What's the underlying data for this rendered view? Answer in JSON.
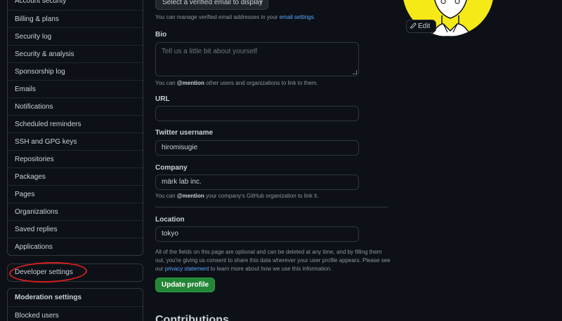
{
  "sidebar": {
    "items": [
      {
        "label": "Account security"
      },
      {
        "label": "Billing & plans"
      },
      {
        "label": "Security log"
      },
      {
        "label": "Security & analysis"
      },
      {
        "label": "Sponsorship log"
      },
      {
        "label": "Emails"
      },
      {
        "label": "Notifications"
      },
      {
        "label": "Scheduled reminders"
      },
      {
        "label": "SSH and GPG keys"
      },
      {
        "label": "Repositories"
      },
      {
        "label": "Packages"
      },
      {
        "label": "Pages"
      },
      {
        "label": "Organizations"
      },
      {
        "label": "Saved replies"
      },
      {
        "label": "Applications"
      }
    ],
    "developer_settings": "Developer settings",
    "moderation": {
      "heading": "Moderation settings",
      "items": [
        {
          "label": "Blocked users"
        }
      ]
    }
  },
  "form": {
    "email_select": "Select a verified email to display",
    "email_note_prefix": "You can manage verified email addresses in your",
    "email_note_link": "email settings.",
    "bio_label": "Bio",
    "bio_placeholder": "Tell us a little bit about yourself",
    "bio_note_prefix": "You can",
    "bio_note_mention": "@mention",
    "bio_note_suffix": "other users and organizations to link to them.",
    "url_label": "URL",
    "url_value": "",
    "twitter_label": "Twitter username",
    "twitter_value": "hiromisugie",
    "company_label": "Company",
    "company_value": "märk lab inc.",
    "company_note_prefix": "You can",
    "company_note_mention": "@mention",
    "company_note_suffix": "your company's GitHub organization to link it.",
    "location_label": "Location",
    "location_value": "tokyo",
    "disclaimer_main": "All of the fields on this page are optional and can be deleted at any time, and by filling them out, you're giving us consent to share this data wherever your user profile appears. Please see our",
    "disclaimer_link": "privacy statement",
    "disclaimer_end": "to learn more about how we use this information.",
    "update_button": "Update profile",
    "next_heading": "Contributions"
  },
  "avatar": {
    "edit_label": "Edit",
    "bg_color": "#f5ea17"
  },
  "colors": {
    "background": "#0d1117",
    "link": "#58a6ff",
    "primary_button": "#238636",
    "annotation": "#d21f1f"
  }
}
